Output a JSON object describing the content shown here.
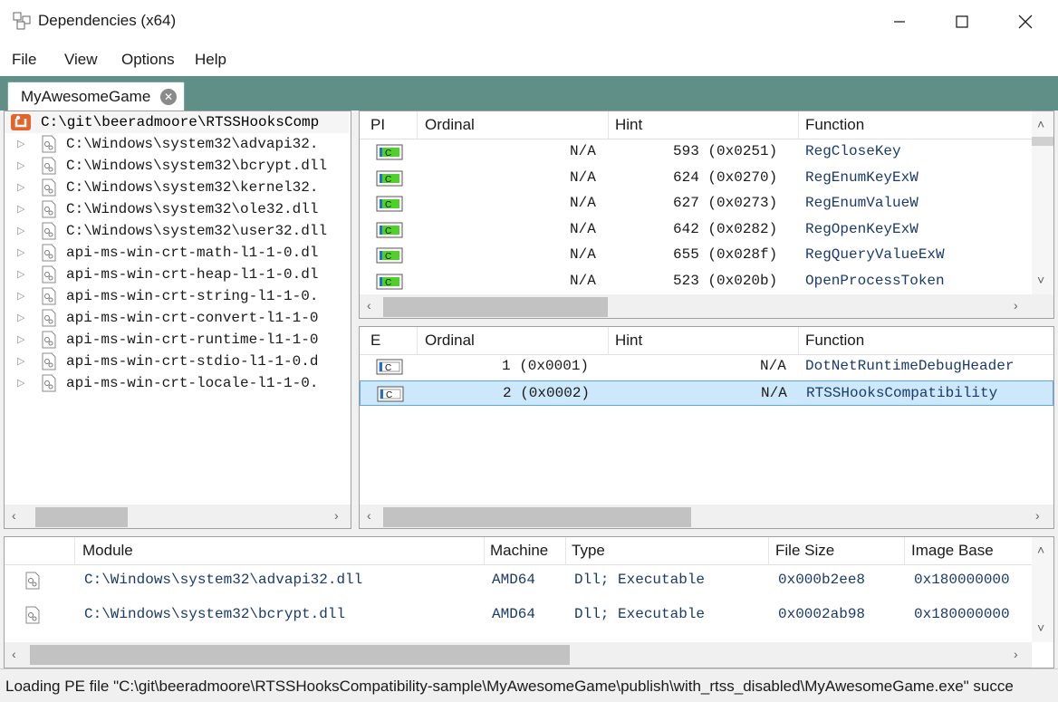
{
  "window": {
    "title": "Dependencies (x64)"
  },
  "menu": [
    "File",
    "View",
    "Options",
    "Help"
  ],
  "tab": {
    "label": "MyAwesomeGame"
  },
  "tree": {
    "root": "C:\\git\\beeradmoore\\RTSSHooksComp",
    "children": [
      "C:\\Windows\\system32\\advapi32.",
      "C:\\Windows\\system32\\bcrypt.dll",
      "C:\\Windows\\system32\\kernel32.",
      "C:\\Windows\\system32\\ole32.dll",
      "C:\\Windows\\system32\\user32.dll",
      "api-ms-win-crt-math-l1-1-0.dl",
      "api-ms-win-crt-heap-l1-1-0.dl",
      "api-ms-win-crt-string-l1-1-0.",
      "api-ms-win-crt-convert-l1-1-0",
      "api-ms-win-crt-runtime-l1-1-0",
      "api-ms-win-crt-stdio-l1-1-0.d",
      "api-ms-win-crt-locale-l1-1-0."
    ]
  },
  "imports": {
    "headers": [
      "PI",
      "Ordinal",
      "Hint",
      "Function"
    ],
    "rows": [
      {
        "ordinal": "N/A",
        "hint": "593 (0x0251)",
        "function": "RegCloseKey"
      },
      {
        "ordinal": "N/A",
        "hint": "624 (0x0270)",
        "function": "RegEnumKeyExW"
      },
      {
        "ordinal": "N/A",
        "hint": "627 (0x0273)",
        "function": "RegEnumValueW"
      },
      {
        "ordinal": "N/A",
        "hint": "642 (0x0282)",
        "function": "RegOpenKeyExW"
      },
      {
        "ordinal": "N/A",
        "hint": "655 (0x028f)",
        "function": "RegQueryValueExW"
      },
      {
        "ordinal": "N/A",
        "hint": "523 (0x020b)",
        "function": "OpenProcessToken"
      }
    ]
  },
  "exports": {
    "headers": [
      "E",
      "Ordinal",
      "Hint",
      "Function"
    ],
    "rows": [
      {
        "ordinal": "1 (0x0001)",
        "hint": "N/A",
        "function": "DotNetRuntimeDebugHeader"
      },
      {
        "ordinal": "2 (0x0002)",
        "hint": "N/A",
        "function": "RTSSHooksCompatibility"
      }
    ]
  },
  "modules": {
    "headers": [
      "Module",
      "Machine",
      "Type",
      "File Size",
      "Image Base"
    ],
    "rows": [
      {
        "module": "C:\\Windows\\system32\\advapi32.dll",
        "machine": "AMD64",
        "type": "Dll; Executable",
        "size": "0x000b2ee8",
        "base": "0x180000000"
      },
      {
        "module": "C:\\Windows\\system32\\bcrypt.dll",
        "machine": "AMD64",
        "type": "Dll; Executable",
        "size": "0x0002ab98",
        "base": "0x180000000"
      }
    ]
  },
  "status": "Loading PE file \"C:\\git\\beeradmoore\\RTSSHooksCompatibility-sample\\MyAwesomeGame\\publish\\with_rtss_disabled\\MyAwesomeGame.exe\" succe"
}
